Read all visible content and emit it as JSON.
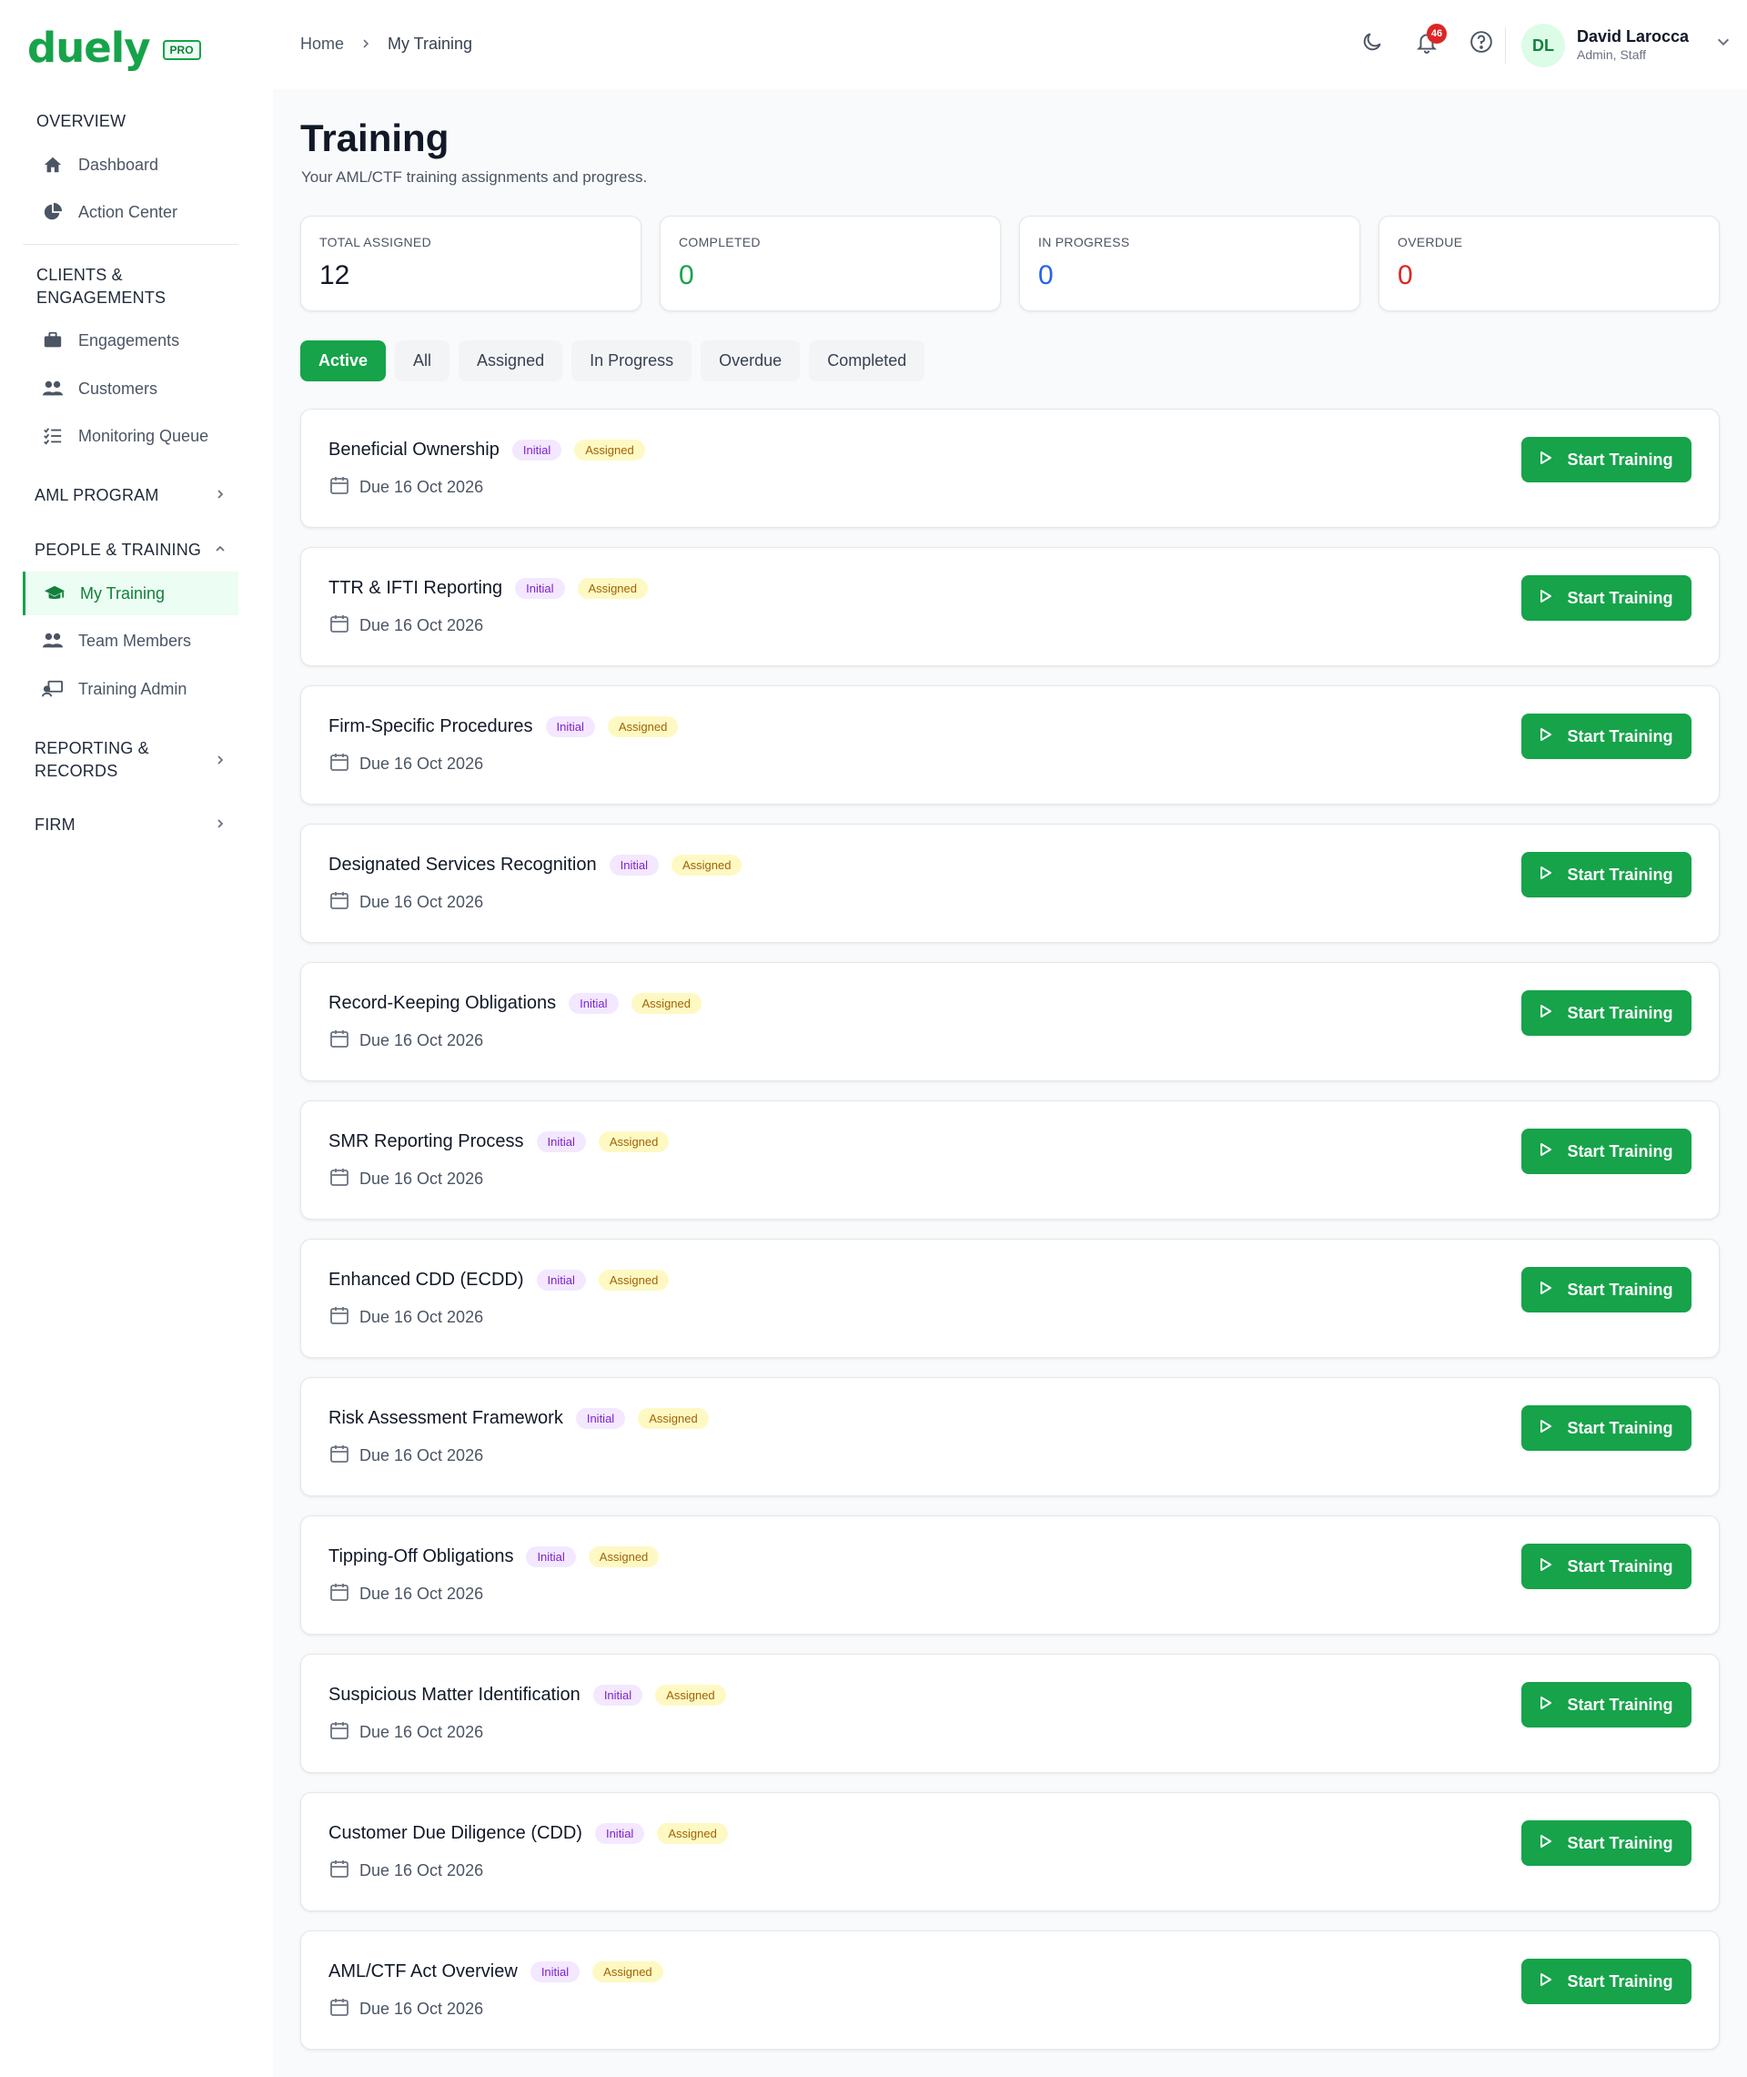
{
  "brand": {
    "logo": "duely",
    "badge": "PRO"
  },
  "sidebar": {
    "sections": [
      {
        "label": "OVERVIEW"
      },
      {
        "label": "CLIENTS & ENGAGEMENTS"
      },
      {
        "label": "AML PROGRAM"
      },
      {
        "label": "PEOPLE & TRAINING"
      },
      {
        "label": "REPORTING & RECORDS"
      },
      {
        "label": "FIRM"
      }
    ],
    "items": [
      {
        "label": "Dashboard",
        "icon": "home-icon"
      },
      {
        "label": "Action Center",
        "icon": "pie-chart-icon"
      },
      {
        "label": "Engagements",
        "icon": "briefcase-icon"
      },
      {
        "label": "Customers",
        "icon": "users-icon"
      },
      {
        "label": "Monitoring Queue",
        "icon": "list-check-icon"
      },
      {
        "label": "My Training",
        "icon": "graduation-cap-icon"
      },
      {
        "label": "Team Members",
        "icon": "users-icon"
      },
      {
        "label": "Training Admin",
        "icon": "chalkboard-icon"
      }
    ]
  },
  "breadcrumb": {
    "home": "Home",
    "current": "My Training"
  },
  "header": {
    "notification_count": "46"
  },
  "user": {
    "initials": "DL",
    "name": "David Larocca",
    "role": "Admin, Staff"
  },
  "page": {
    "title": "Training",
    "subtitle": "Your AML/CTF training assignments and progress."
  },
  "stats": [
    {
      "label": "TOTAL ASSIGNED",
      "value": "12",
      "color": "#111827"
    },
    {
      "label": "COMPLETED",
      "value": "0",
      "color": "#16a34a"
    },
    {
      "label": "IN PROGRESS",
      "value": "0",
      "color": "#2563eb"
    },
    {
      "label": "OVERDUE",
      "value": "0",
      "color": "#dc2626"
    }
  ],
  "tabs": [
    "Active",
    "All",
    "Assigned",
    "In Progress",
    "Overdue",
    "Completed"
  ],
  "active_tab": "Active",
  "trainings": [
    {
      "title": "Beneficial Ownership",
      "type": "Initial",
      "status": "Assigned",
      "due": "Due 16 Oct 2026",
      "action": "Start Training"
    },
    {
      "title": "TTR & IFTI Reporting",
      "type": "Initial",
      "status": "Assigned",
      "due": "Due 16 Oct 2026",
      "action": "Start Training"
    },
    {
      "title": "Firm-Specific Procedures",
      "type": "Initial",
      "status": "Assigned",
      "due": "Due 16 Oct 2026",
      "action": "Start Training"
    },
    {
      "title": "Designated Services Recognition",
      "type": "Initial",
      "status": "Assigned",
      "due": "Due 16 Oct 2026",
      "action": "Start Training"
    },
    {
      "title": "Record-Keeping Obligations",
      "type": "Initial",
      "status": "Assigned",
      "due": "Due 16 Oct 2026",
      "action": "Start Training"
    },
    {
      "title": "SMR Reporting Process",
      "type": "Initial",
      "status": "Assigned",
      "due": "Due 16 Oct 2026",
      "action": "Start Training"
    },
    {
      "title": "Enhanced CDD (ECDD)",
      "type": "Initial",
      "status": "Assigned",
      "due": "Due 16 Oct 2026",
      "action": "Start Training"
    },
    {
      "title": "Risk Assessment Framework",
      "type": "Initial",
      "status": "Assigned",
      "due": "Due 16 Oct 2026",
      "action": "Start Training"
    },
    {
      "title": "Tipping-Off Obligations",
      "type": "Initial",
      "status": "Assigned",
      "due": "Due 16 Oct 2026",
      "action": "Start Training"
    },
    {
      "title": "Suspicious Matter Identification",
      "type": "Initial",
      "status": "Assigned",
      "due": "Due 16 Oct 2026",
      "action": "Start Training"
    },
    {
      "title": "Customer Due Diligence (CDD)",
      "type": "Initial",
      "status": "Assigned",
      "due": "Due 16 Oct 2026",
      "action": "Start Training"
    },
    {
      "title": "AML/CTF Act Overview",
      "type": "Initial",
      "status": "Assigned",
      "due": "Due 16 Oct 2026",
      "action": "Start Training"
    }
  ]
}
